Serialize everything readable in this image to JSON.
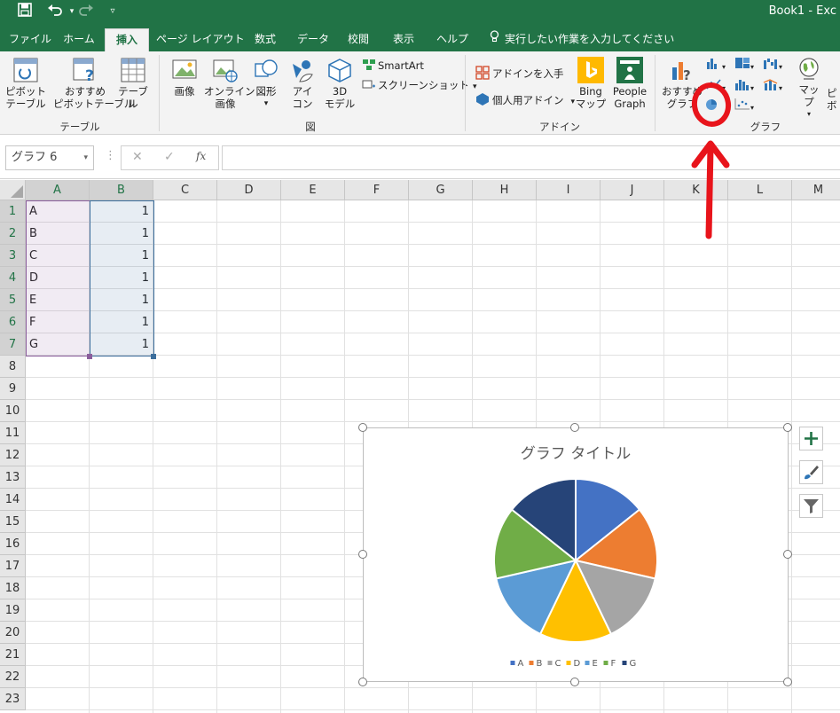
{
  "window": {
    "title": "Book1  -  Exc"
  },
  "quick_access": {
    "save_icon": "save-icon",
    "undo_icon": "undo-icon",
    "redo_icon": "redo-icon",
    "customize_icon": "customize-icon"
  },
  "tabs": [
    {
      "label": "ファイル"
    },
    {
      "label": "ホーム"
    },
    {
      "label": "挿入"
    },
    {
      "label": "ページ レイアウト"
    },
    {
      "label": "数式"
    },
    {
      "label": "データ"
    },
    {
      "label": "校閲"
    },
    {
      "label": "表示"
    },
    {
      "label": "ヘルプ"
    },
    {
      "label": "実行したい作業を入力してください"
    }
  ],
  "ribbon": {
    "table_group": {
      "pivot": "ピボット\nテーブル",
      "recommended_pivot": "おすすめ\nピボットテーブル",
      "table": "テーブル",
      "label": "テーブル"
    },
    "figure_group": {
      "image": "画像",
      "online_image": "オンライン\n画像",
      "shapes": "図形",
      "icons": "アイ\nコン",
      "model3d": "3D\nモデル",
      "smartart": "SmartArt",
      "screenshot": "スクリーンショット",
      "label": "図"
    },
    "addin_group": {
      "get_addins": "アドインを入手",
      "my_addins": "個人用アドイン",
      "bing_maps": "Bing\nマップ",
      "people_graph": "People\nGraph",
      "label": "アドイン"
    },
    "chart_group": {
      "recommended": "おすすめ\nグラフ",
      "label": "グラフ",
      "maps": "マップ",
      "pivot_chart": "ピボ"
    }
  },
  "formula_bar": {
    "name_box": "グラフ 6",
    "cancel": "✕",
    "enter": "✓",
    "fx": "fx",
    "value": ""
  },
  "grid": {
    "columns": [
      "A",
      "B",
      "C",
      "D",
      "E",
      "F",
      "G",
      "H",
      "I",
      "J",
      "K",
      "L",
      "M"
    ],
    "rows": [
      "1",
      "2",
      "3",
      "4",
      "5",
      "6",
      "7",
      "8",
      "9",
      "10",
      "11",
      "12",
      "13",
      "14",
      "15",
      "16",
      "17",
      "18",
      "19",
      "20",
      "21",
      "22",
      "23"
    ],
    "data": [
      [
        "A",
        "1"
      ],
      [
        "B",
        "1"
      ],
      [
        "C",
        "1"
      ],
      [
        "D",
        "1"
      ],
      [
        "E",
        "1"
      ],
      [
        "F",
        "1"
      ],
      [
        "G",
        "1"
      ]
    ]
  },
  "chart_data": {
    "type": "pie",
    "title": "グラフ タイトル",
    "categories": [
      "A",
      "B",
      "C",
      "D",
      "E",
      "F",
      "G"
    ],
    "values": [
      1,
      1,
      1,
      1,
      1,
      1,
      1
    ],
    "colors": [
      "#4472C4",
      "#ED7D31",
      "#A5A5A5",
      "#FFC000",
      "#5B9BD5",
      "#70AD47",
      "#264478"
    ],
    "legend": "bottom"
  },
  "chart_tools": {
    "add_element": "plus-icon",
    "styles": "brush-icon",
    "filters": "filter-icon"
  },
  "annotation": {
    "color": "#e8141b"
  }
}
